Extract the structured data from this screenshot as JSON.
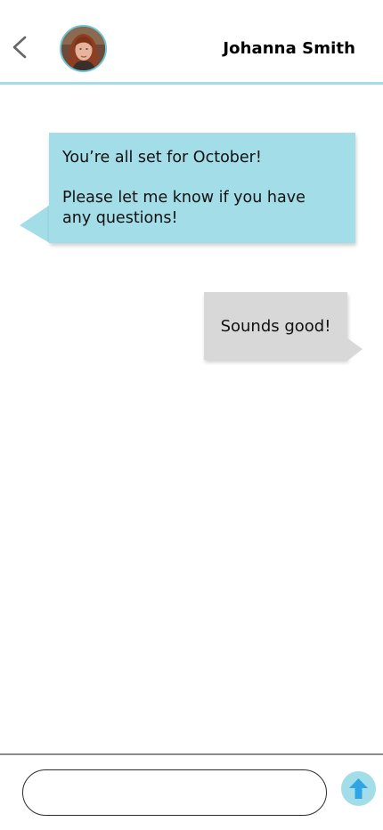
{
  "header": {
    "contact_name": "Johanna Smith",
    "back_icon": "chevron-left-icon",
    "avatar_description": "contact-photo"
  },
  "messages": [
    {
      "direction": "incoming",
      "lines": [
        "You’re all set for October!",
        "Please let me know if you have",
        "any questions!"
      ]
    },
    {
      "direction": "outgoing",
      "lines": [
        "Sounds good!"
      ]
    }
  ],
  "composer": {
    "input_value": "",
    "placeholder": "",
    "send_icon": "arrow-up-icon"
  },
  "colors": {
    "accent": "#a3dde7",
    "outgoing_bubble": "#d8d8d8",
    "header_divider": "#a3dde7",
    "text": "#111111"
  }
}
